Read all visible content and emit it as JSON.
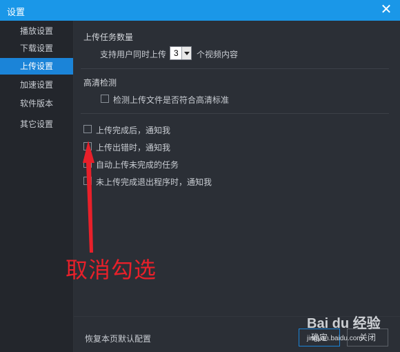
{
  "window": {
    "title": "设置",
    "close_icon": "close-icon"
  },
  "sidebar": {
    "items": [
      {
        "label": "播放设置",
        "active": false
      },
      {
        "label": "下载设置",
        "active": false
      },
      {
        "label": "上传设置",
        "active": true
      },
      {
        "label": "加速设置",
        "active": false
      },
      {
        "label": "软件版本",
        "active": false
      },
      {
        "label": "其它设置",
        "active": false
      }
    ]
  },
  "upload_count": {
    "title": "上传任务数量",
    "prefix": "支持用户同时上传",
    "value": "3",
    "suffix": "个视频内容"
  },
  "hd": {
    "title": "高清检测",
    "check_label": "检测上传文件是否符合高清标准",
    "checked": false
  },
  "notify": {
    "items": [
      {
        "label": "上传完成后，通知我",
        "checked": false
      },
      {
        "label": "上传出错时，通知我",
        "checked": false
      },
      {
        "label": "自动上传未完成的任务",
        "checked": false
      },
      {
        "label": "未上传完成退出程序时，通知我",
        "checked": false
      }
    ]
  },
  "annotation": {
    "text": "取消勾选",
    "color": "#e8202a"
  },
  "footer": {
    "restore_label": "恢复本页默认配置",
    "ok_label": "确定",
    "cancel_label": "关闭"
  },
  "watermark": {
    "brand": "Bai du 经验",
    "url": "jingyan.baidu.com"
  },
  "colors": {
    "accent": "#1a97e8",
    "active": "#1b84d8",
    "annotation": "#e8202a"
  }
}
